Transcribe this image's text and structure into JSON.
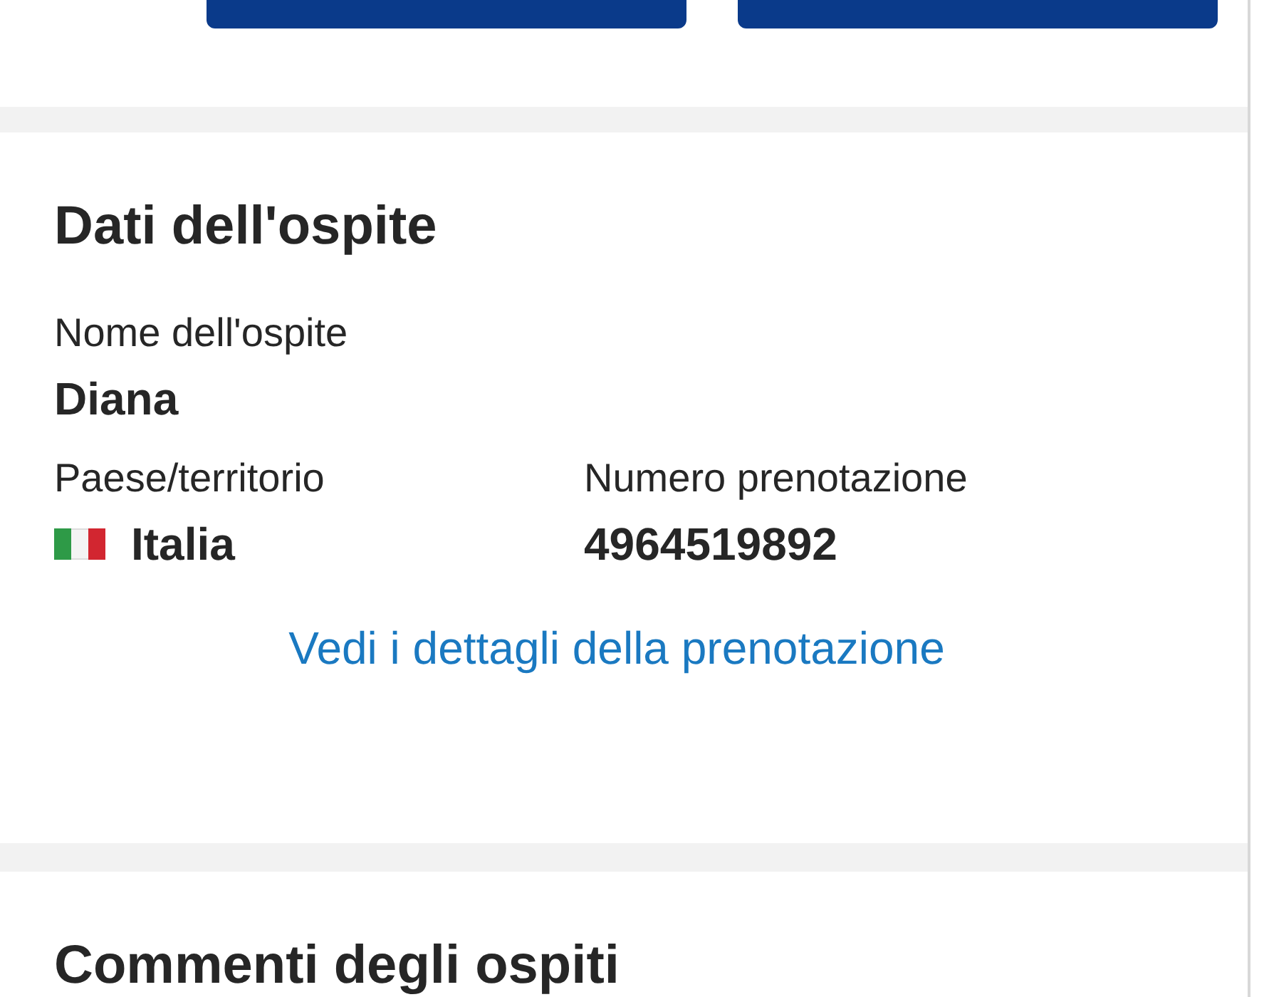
{
  "guest_section": {
    "title": "Dati dell'ospite",
    "fields": [
      {
        "label": "Nome dell'ospite",
        "value": "Diana",
        "kind": "text"
      },
      {
        "label": "Paese/territorio",
        "value": "Italia",
        "kind": "country"
      },
      {
        "label": "Numero prenotazione",
        "value": "4964519892",
        "kind": "text"
      }
    ],
    "link": "Vedi i dettagli della prenotazione"
  },
  "comments_section": {
    "title": "Commenti degli ospiti"
  }
}
